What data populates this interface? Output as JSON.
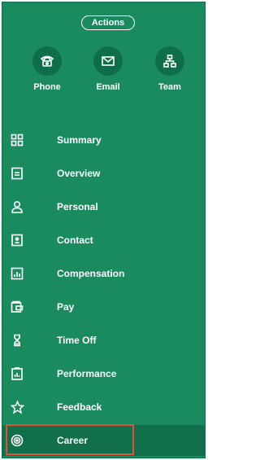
{
  "actions_label": "Actions",
  "quick_actions": [
    {
      "label": "Phone",
      "icon": "phone-icon"
    },
    {
      "label": "Email",
      "icon": "email-icon"
    },
    {
      "label": "Team",
      "icon": "team-icon"
    }
  ],
  "nav": [
    {
      "label": "Summary",
      "icon": "grid-icon"
    },
    {
      "label": "Overview",
      "icon": "document-icon"
    },
    {
      "label": "Personal",
      "icon": "person-icon"
    },
    {
      "label": "Contact",
      "icon": "contact-card-icon"
    },
    {
      "label": "Compensation",
      "icon": "chart-icon"
    },
    {
      "label": "Pay",
      "icon": "wallet-icon"
    },
    {
      "label": "Time Off",
      "icon": "hourglass-icon"
    },
    {
      "label": "Performance",
      "icon": "performance-icon"
    },
    {
      "label": "Feedback",
      "icon": "star-icon"
    },
    {
      "label": "Career",
      "icon": "target-icon"
    }
  ],
  "active_item": "Career",
  "colors": {
    "panel": "#1a8a5f",
    "active_bg": "#126f4c",
    "highlight": "#e0533a"
  }
}
